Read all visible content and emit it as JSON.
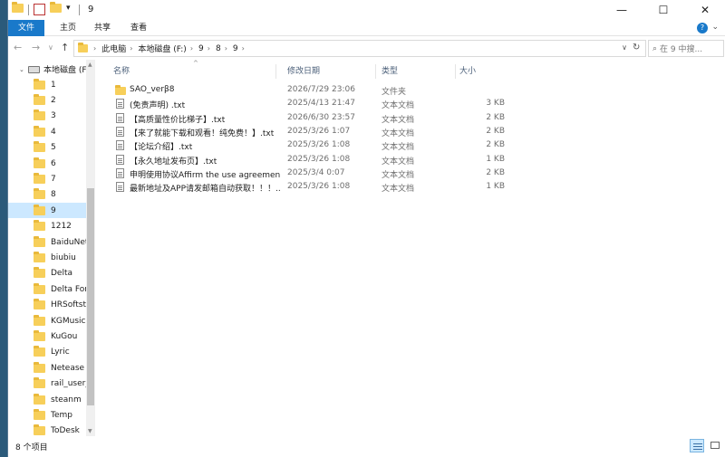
{
  "window": {
    "title": "9",
    "controls": {
      "minimize": "—",
      "maximize": "☐",
      "close": "✕"
    }
  },
  "ribbon": {
    "tabs": [
      "文件",
      "主页",
      "共享",
      "查看"
    ],
    "expand_icon": "chevron-down-icon",
    "help_icon": "?"
  },
  "address": {
    "crumbs": [
      "此电脑",
      "本地磁盘 (F:)",
      "9",
      "8",
      "9"
    ],
    "search_placeholder": "在 9 中搜..."
  },
  "nav": {
    "drive": "本地磁盘 (F:)",
    "items": [
      "1",
      "2",
      "3",
      "4",
      "5",
      "6",
      "7",
      "8",
      "9",
      "1212",
      "BaiduNetd",
      "biubiu",
      "Delta",
      "Delta Force",
      "HRSoftsto",
      "KGMusic",
      "KuGou",
      "Lyric",
      "Netease",
      "rail_user_d",
      "steanm",
      "Temp",
      "ToDesk"
    ],
    "selected_index": 8
  },
  "columns": {
    "name": "名称",
    "date": "修改日期",
    "type": "类型",
    "size": "大小"
  },
  "files": [
    {
      "name": "SAO_verβ8",
      "date": "2026/7/29 23:06",
      "type": "文件夹",
      "size": "",
      "icon": "folder-icon"
    },
    {
      "name": "(免责声明) .txt",
      "date": "2025/4/13 21:47",
      "type": "文本文档",
      "size": "3 KB",
      "icon": "text-file-icon"
    },
    {
      "name": "【高质量性价比梯子】.txt",
      "date": "2026/6/30 23:57",
      "type": "文本文档",
      "size": "2 KB",
      "icon": "text-file-icon"
    },
    {
      "name": "【来了就能下载和观看！纯免费！】.txt",
      "date": "2025/3/26 1:07",
      "type": "文本文档",
      "size": "2 KB",
      "icon": "text-file-icon"
    },
    {
      "name": "【论坛介绍】.txt",
      "date": "2025/3/26 1:08",
      "type": "文本文档",
      "size": "2 KB",
      "icon": "text-file-icon"
    },
    {
      "name": "【永久地址发布页】.txt",
      "date": "2025/3/26 1:08",
      "type": "文本文档",
      "size": "1 KB",
      "icon": "text-file-icon"
    },
    {
      "name": "申明使用协议Affirm the use agreemen...",
      "date": "2025/3/4 0:07",
      "type": "文本文档",
      "size": "2 KB",
      "icon": "text-file-icon"
    },
    {
      "name": "最新地址及APP请发邮箱自动获取！！！....",
      "date": "2025/3/26 1:08",
      "type": "文本文档",
      "size": "1 KB",
      "icon": "text-file-icon"
    }
  ],
  "status": {
    "count": "8 个项目"
  },
  "colors": {
    "accent": "#1979ca",
    "selection": "#cce8ff",
    "folder": "#f7cf5a"
  }
}
